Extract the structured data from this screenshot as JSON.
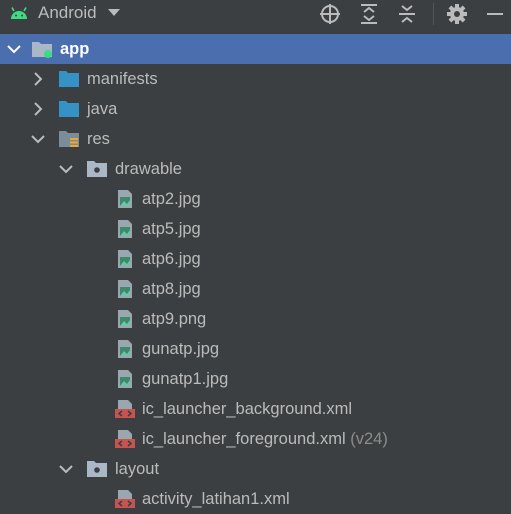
{
  "toolbar": {
    "view_mode": "Android",
    "icons": [
      "android-icon",
      "dropdown-caret-icon",
      "locate-icon",
      "expand-all-icon",
      "collapse-all-icon",
      "settings-gear-icon",
      "hide-minus-icon"
    ]
  },
  "tree": {
    "app": "app",
    "manifests": "manifests",
    "java": "java",
    "res": "res",
    "drawable": "drawable",
    "drawable_files": [
      "atp2.jpg",
      "atp5.jpg",
      "atp6.jpg",
      "atp8.jpg",
      "atp9.png",
      "gunatp.jpg",
      "gunatp1.jpg"
    ],
    "xml_files": [
      "ic_launcher_background.xml",
      "ic_launcher_foreground.xml"
    ],
    "foreground_qualifier": "(v24)",
    "layout": "layout",
    "layout_file": "activity_latihan1.xml"
  },
  "colors": {
    "panel_bg": "#3c3f41",
    "selection": "#4b6eaf",
    "folder_blue": "#3592c4",
    "xml_orange": "#c75450",
    "android_green": "#3ddc84"
  }
}
